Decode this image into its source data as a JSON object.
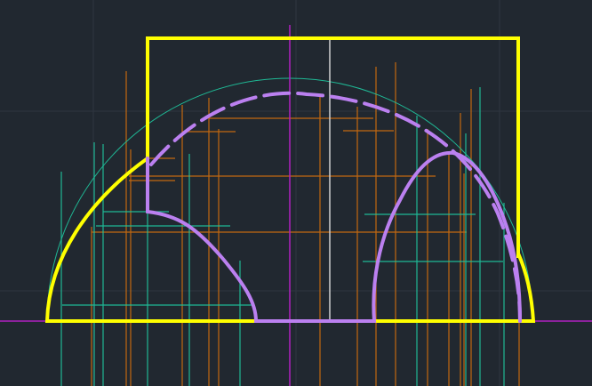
{
  "colors": {
    "background": "#212830",
    "grid": "#2e3640",
    "outline": "#ffff00",
    "profile": "#bb80f0",
    "construction_orange": "#d4700c",
    "construction_teal": "#1fc8a0",
    "axis_magenta": "#b020c0",
    "axis_white": "#d0d0d0"
  }
}
